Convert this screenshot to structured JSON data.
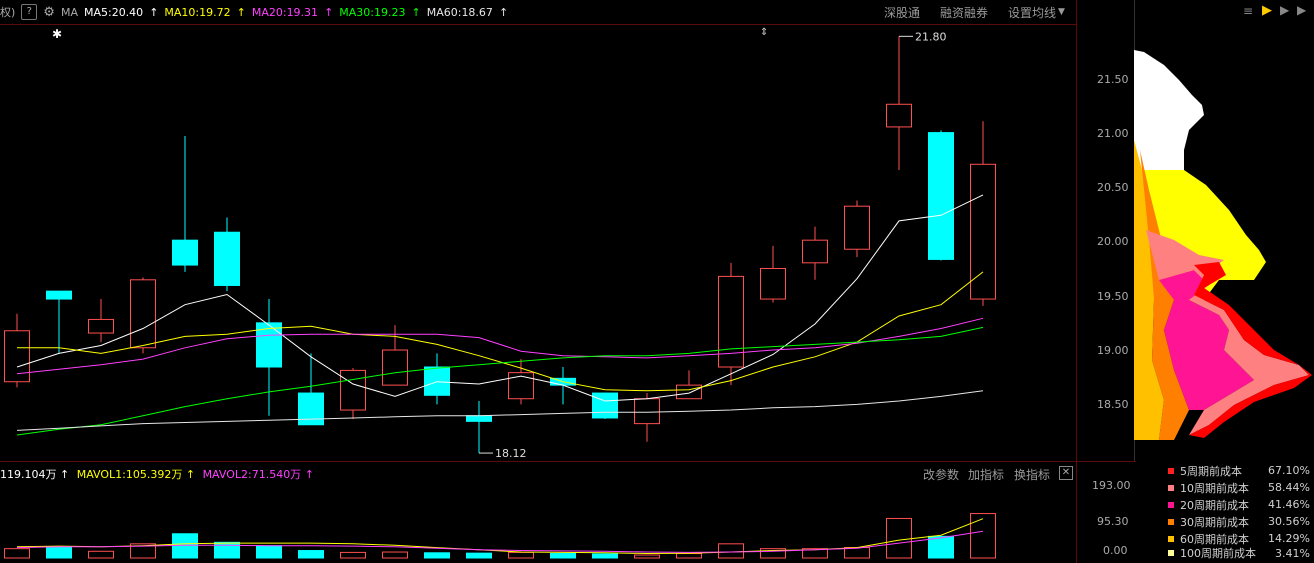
{
  "toolbar": {
    "left_glyph": "权)",
    "help_icon": "?",
    "ma_label": "MA",
    "ma5": "MA5:20.40",
    "ma10": "MA10:19.72",
    "ma20": "MA20:19.31",
    "ma30": "MA30:19.23",
    "ma60": "MA60:18.67",
    "shenzhen_connect": "深股通",
    "margin_trading": "融资融券",
    "ma_settings": "设置均线"
  },
  "colors": {
    "ma5": "#ffffff",
    "ma10": "#ffff00",
    "ma20": "#ff40ff",
    "ma30": "#00ff00",
    "ma60": "#e6e6e6",
    "up": "#ff5050",
    "down": "#00ffff",
    "axis_line": "#7a0000"
  },
  "price_axis": {
    "ticks": [
      "21.50",
      "21.00",
      "20.50",
      "20.00",
      "19.50",
      "19.00",
      "18.50"
    ]
  },
  "volume_axis": {
    "ticks": [
      "193.00",
      "95.30",
      "0.00"
    ]
  },
  "annotations": {
    "high": "21.80",
    "low": "18.12"
  },
  "volume_bar": {
    "vol": "119.104万",
    "mavol1": "MAVOL1:105.392万",
    "mavol2": "MAVOL2:71.540万",
    "modify_params": "改参数",
    "add_indicator": "加指标",
    "change_indicator": "换指标"
  },
  "cost_distribution": {
    "rows": [
      {
        "label": "5周期前成本",
        "value": "67.10%",
        "color": "#ff2020"
      },
      {
        "label": "10周期前成本",
        "value": "58.44%",
        "color": "#ff8080"
      },
      {
        "label": "20周期前成本",
        "value": "41.46%",
        "color": "#ff1493"
      },
      {
        "label": "30周期前成本",
        "value": "30.56%",
        "color": "#ff8000"
      },
      {
        "label": "60周期前成本",
        "value": "14.29%",
        "color": "#ffc000"
      },
      {
        "label": "100周期前成本",
        "value": "3.41%",
        "color": "#ffff99"
      }
    ]
  },
  "chart_data": {
    "type": "candlestick",
    "ylim": [
      18.05,
      21.9
    ],
    "candles": [
      {
        "o": 18.75,
        "c": 19.2,
        "h": 19.35,
        "l": 18.7
      },
      {
        "o": 19.55,
        "c": 19.48,
        "h": 19.55,
        "l": 19.0
      },
      {
        "o": 19.18,
        "c": 19.3,
        "h": 19.48,
        "l": 19.1
      },
      {
        "o": 19.05,
        "c": 19.65,
        "h": 19.67,
        "l": 19.0
      },
      {
        "o": 20.0,
        "c": 19.78,
        "h": 20.92,
        "l": 19.72
      },
      {
        "o": 20.07,
        "c": 19.6,
        "h": 20.2,
        "l": 19.55
      },
      {
        "o": 19.27,
        "c": 18.88,
        "h": 19.48,
        "l": 18.45
      },
      {
        "o": 18.65,
        "c": 18.37,
        "h": 19.0,
        "l": 18.37
      },
      {
        "o": 18.5,
        "c": 18.85,
        "h": 18.87,
        "l": 18.42
      },
      {
        "o": 18.72,
        "c": 19.03,
        "h": 19.25,
        "l": 18.72
      },
      {
        "o": 18.88,
        "c": 18.63,
        "h": 19.0,
        "l": 18.55
      },
      {
        "o": 18.45,
        "c": 18.4,
        "h": 18.58,
        "l": 18.12
      },
      {
        "o": 18.6,
        "c": 18.83,
        "h": 18.95,
        "l": 18.55
      },
      {
        "o": 18.78,
        "c": 18.72,
        "h": 18.88,
        "l": 18.55
      },
      {
        "o": 18.65,
        "c": 18.43,
        "h": 18.65,
        "l": 18.42
      },
      {
        "o": 18.38,
        "c": 18.6,
        "h": 18.65,
        "l": 18.22
      },
      {
        "o": 18.6,
        "c": 18.72,
        "h": 18.85,
        "l": 18.6
      },
      {
        "o": 18.88,
        "c": 19.68,
        "h": 19.8,
        "l": 18.72
      },
      {
        "o": 19.48,
        "c": 19.75,
        "h": 19.95,
        "l": 19.45
      },
      {
        "o": 19.8,
        "c": 20.0,
        "h": 20.12,
        "l": 19.65
      },
      {
        "o": 19.92,
        "c": 20.3,
        "h": 20.35,
        "l": 19.85
      },
      {
        "o": 21.0,
        "c": 21.2,
        "h": 21.8,
        "l": 20.62
      },
      {
        "o": 20.95,
        "c": 19.83,
        "h": 20.97,
        "l": 19.82
      },
      {
        "o": 19.48,
        "c": 20.67,
        "h": 21.05,
        "l": 19.42
      }
    ],
    "ma5": [
      18.88,
      19.0,
      19.07,
      19.22,
      19.43,
      19.52,
      19.25,
      18.97,
      18.73,
      18.62,
      18.75,
      18.73,
      18.8,
      18.72,
      18.58,
      18.6,
      18.65,
      18.82,
      18.99,
      19.26,
      19.66,
      20.17,
      20.22,
      20.4
    ],
    "ma10": [
      19.05,
      19.05,
      19.0,
      19.07,
      19.15,
      19.17,
      19.22,
      19.24,
      19.17,
      19.15,
      19.08,
      18.98,
      18.87,
      18.75,
      18.68,
      18.67,
      18.68,
      18.76,
      18.88,
      18.97,
      19.1,
      19.33,
      19.43,
      19.72
    ],
    "ma20": [
      18.82,
      18.86,
      18.9,
      18.95,
      19.05,
      19.13,
      19.16,
      19.17,
      19.17,
      19.17,
      19.17,
      19.14,
      19.02,
      18.98,
      18.97,
      18.96,
      18.98,
      19.0,
      19.03,
      19.05,
      19.09,
      19.15,
      19.22,
      19.31
    ],
    "ma30": [
      18.28,
      18.33,
      18.37,
      18.45,
      18.53,
      18.6,
      18.66,
      18.71,
      18.77,
      18.83,
      18.87,
      18.9,
      18.93,
      18.96,
      18.98,
      18.98,
      19.0,
      19.04,
      19.06,
      19.08,
      19.1,
      19.12,
      19.15,
      19.23
    ],
    "ma60": [
      18.32,
      18.34,
      18.36,
      18.38,
      18.39,
      18.4,
      18.41,
      18.42,
      18.43,
      18.44,
      18.45,
      18.45,
      18.46,
      18.47,
      18.48,
      18.48,
      18.49,
      18.5,
      18.52,
      18.53,
      18.55,
      18.58,
      18.62,
      18.67
    ],
    "volume": [
      25,
      30,
      18,
      38,
      65,
      42,
      33,
      20,
      15,
      16,
      14,
      13,
      15,
      12,
      11,
      8,
      12,
      38,
      25,
      25,
      28,
      106,
      58,
      119.104
    ],
    "mavol1": [
      30,
      32,
      30,
      33,
      38,
      40,
      40,
      40,
      38,
      34,
      28,
      22,
      16,
      15,
      14,
      12,
      13,
      16,
      20,
      22,
      28,
      48,
      61,
      105.392
    ],
    "mavol2": [
      28,
      30,
      30,
      32,
      34,
      34,
      33,
      33,
      32,
      30,
      26,
      22,
      20,
      19,
      18,
      16,
      15,
      16,
      18,
      22,
      26,
      40,
      54,
      71.54
    ]
  }
}
